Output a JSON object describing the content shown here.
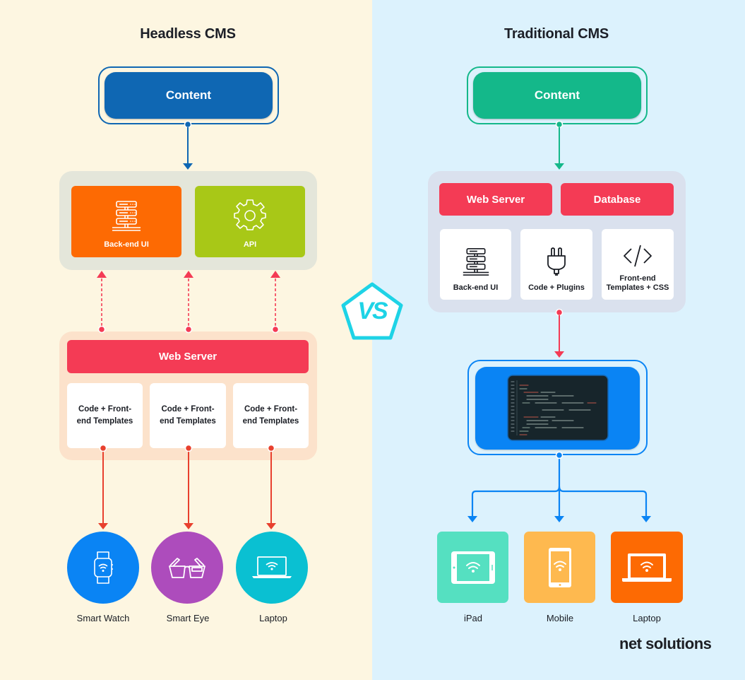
{
  "left": {
    "title": "Headless CMS",
    "content_label": "Content",
    "backend_tiles": [
      {
        "label": "Back-end UI",
        "icon": "server-stack-icon",
        "color": "#fd6a03"
      },
      {
        "label": "API",
        "icon": "gear-icon",
        "color": "#a8c817"
      }
    ],
    "web_server_label": "Web Server",
    "template_tiles": [
      {
        "line1": "Code + Front-",
        "line2": "end Templates"
      },
      {
        "line1": "Code + Front-",
        "line2": "end Templates"
      },
      {
        "line1": "Code + Front-",
        "line2": "end Templates"
      }
    ],
    "devices": [
      {
        "label": "Smart Watch",
        "icon": "smartwatch-icon",
        "color": "#0a84f4"
      },
      {
        "label": "Smart Eye",
        "icon": "smart-glasses-icon",
        "color": "#ad4cbc"
      },
      {
        "label": "Laptop",
        "icon": "laptop-icon",
        "color": "#0ac0d2"
      }
    ]
  },
  "right": {
    "title": "Traditional CMS",
    "content_label": "Content",
    "top_bars": [
      {
        "label": "Web Server"
      },
      {
        "label": "Database"
      }
    ],
    "tiles": [
      {
        "label": "Back-end UI",
        "icon": "server-stack-icon"
      },
      {
        "label": "Code + Plugins",
        "icon": "plug-icon"
      },
      {
        "line1": "Front-end",
        "line2": "Templates + CSS",
        "icon": "code-brackets-icon"
      }
    ],
    "display_icon": "code-editor-screen-icon",
    "devices": [
      {
        "label": "iPad",
        "icon": "tablet-icon",
        "color": "#55e0c1"
      },
      {
        "label": "Mobile",
        "icon": "mobile-icon",
        "color": "#feb94f"
      },
      {
        "label": "Laptop",
        "icon": "laptop-icon",
        "color": "#fd6a03"
      }
    ]
  },
  "vs_label": "VS",
  "brand": {
    "name_part1": "net so",
    "name_part2": "lutions"
  },
  "colors": {
    "headless_blue": "#0f67b3",
    "traditional_green": "#14b88a",
    "red": "#f43b55",
    "blue": "#0a84f4",
    "cyan": "#1ed3e6"
  }
}
